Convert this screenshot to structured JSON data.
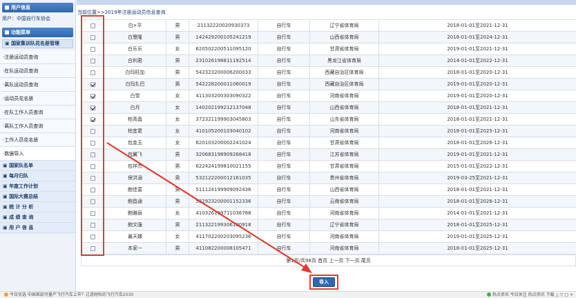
{
  "sidebar": {
    "user_header": "用户信息",
    "user_line": "用户：中国自行车协会",
    "menu_header": "功能菜单",
    "section_title": "国家集训队花名册管理",
    "items": [
      {
        "label": "·注册运动员查询"
      },
      {
        "label": "·在队运动员查询"
      },
      {
        "label": "·离队运动员查询"
      },
      {
        "label": "·运动员花名册"
      },
      {
        "label": "·在队工作人员查询"
      },
      {
        "label": "·离队工作人员查询"
      },
      {
        "label": "·工作人员花名册"
      },
      {
        "label": "·数据导入"
      }
    ],
    "groups": [
      {
        "label": "国家队名单"
      },
      {
        "label": "每月归队"
      },
      {
        "label": "年度工作计划"
      },
      {
        "label": "国际大赛总结"
      },
      {
        "label": "统 计 分 析"
      },
      {
        "label": "成 绩 查 询"
      },
      {
        "label": "用 户 信 息"
      }
    ]
  },
  "breadcrumb": "当前位置>>2019年注册运动员信息查询",
  "table": {
    "rows": [
      {
        "checked": false,
        "name": "白×平",
        "gender": "男",
        "id": "21132220020930373",
        "sport": "自行车",
        "org": "辽宁省体育局",
        "period": "2018-01-01至2021-12-31"
      },
      {
        "checked": false,
        "name": "白慧隆",
        "gender": "男",
        "id": "142429200105241219",
        "sport": "自行车",
        "org": "山西省体育局",
        "period": "2018-01-01至2024-12-31"
      },
      {
        "checked": false,
        "name": "白乐乐",
        "gender": "女",
        "id": "620502200511095120",
        "sport": "自行车",
        "org": "甘肃省体育局",
        "period": "2019-01-01至2021-12-31"
      },
      {
        "checked": false,
        "name": "白利君",
        "gender": "男",
        "id": "231026198811192514",
        "sport": "自行车",
        "org": "黑龙江省体育局",
        "period": "2014-01-01至2022-12-31"
      },
      {
        "checked": false,
        "name": "白玛旺加",
        "gender": "男",
        "id": "542323200006200033",
        "sport": "自行车",
        "org": "西藏自治区体育局",
        "period": "2018-01-01至2020-12-31"
      },
      {
        "checked": true,
        "name": "白玛扎巴",
        "gender": "男",
        "id": "542228200011060019",
        "sport": "自行车",
        "org": "西藏自治区体育局",
        "period": "2019-01-01至2020-12-31"
      },
      {
        "checked": true,
        "name": "白雪",
        "gender": "女",
        "id": "411303200303090322",
        "sport": "自行车",
        "org": "河南省体育局",
        "period": "2019-01-01至2020-12-31"
      },
      {
        "checked": true,
        "name": "白月",
        "gender": "女",
        "id": "140202199212137048",
        "sport": "自行车",
        "org": "山西省体育局",
        "period": "2018-01-01至2021-12-31"
      },
      {
        "checked": true,
        "name": "柏青晶",
        "gender": "女",
        "id": "372321199903045803",
        "sport": "自行车",
        "org": "山东省体育局",
        "period": "2018-01-01至2021-12-31"
      },
      {
        "checked": false,
        "name": "柏宜君",
        "gender": "女",
        "id": "410105200103040102",
        "sport": "自行车",
        "org": "河南省体育局",
        "period": "2018-01-01至2025-12-31"
      },
      {
        "checked": false,
        "name": "包金玉",
        "gender": "女",
        "id": "620103200002241024",
        "sport": "自行车",
        "org": "甘肃省体育局",
        "period": "2018-01-01至2026-12-31"
      },
      {
        "checked": false,
        "name": "包翼飞",
        "gender": "男",
        "id": "320683198909268418",
        "sport": "自行车",
        "org": "江苏省体育局",
        "period": "2019-01-01至2021-12-31"
      },
      {
        "checked": false,
        "name": "包祥杰",
        "gender": "男",
        "id": "622424199810021155",
        "sport": "自行车",
        "org": "甘肃省体育局",
        "period": "2015-01-01至2022-12-31"
      },
      {
        "checked": false,
        "name": "保洪涵",
        "gender": "男",
        "id": "532122200012161035",
        "sport": "自行车",
        "org": "贵州省体育局",
        "period": "2019-03-25至2021-12-31"
      },
      {
        "checked": false,
        "name": "鲍佳富",
        "gender": "男",
        "id": "511124199909092436",
        "sport": "自行车",
        "org": "山西省体育局",
        "period": "2018-01-01至2021-12-31"
      },
      {
        "checked": false,
        "name": "鲍昌通",
        "gender": "男",
        "id": "532923200001152336",
        "sport": "自行车",
        "org": "云南省体育局",
        "period": "2018-01-01至2026-12-31"
      },
      {
        "checked": false,
        "name": "鲍雅丽",
        "gender": "女",
        "id": "410326199711036788",
        "sport": "自行车",
        "org": "河南省体育局",
        "period": "2014-01-01至2021-12-31"
      },
      {
        "checked": false,
        "name": "鲍文强",
        "gender": "男",
        "id": "211322199306100918",
        "sport": "自行车",
        "org": "辽宁省体育局",
        "period": "2018-01-01至2025-12-31"
      },
      {
        "checked": false,
        "name": "暴天娜",
        "gender": "女",
        "id": "411702200203095236",
        "sport": "自行车",
        "org": "河南省体育局",
        "period": "2019-01-01至2025-12-31"
      },
      {
        "checked": false,
        "name": "本家一",
        "gender": "男",
        "id": "411082200008105471",
        "sport": "自行车",
        "org": "河南省体育局",
        "period": "2018-01-01至2025-12-31"
      }
    ]
  },
  "pager": "第1页/共98页 首页 上一页 下一页 尾页",
  "import_button": "导入",
  "statusbar": {
    "left": "今日优选    中国首款可量产飞行汽车上市？过滤材料的飞行汽车2030",
    "right": "热点资讯  今日关注  热点资讯  下载  △  ▽  □  ×"
  },
  "colors": {
    "accent": "#2f68b0",
    "annotation": "#e03c31"
  }
}
